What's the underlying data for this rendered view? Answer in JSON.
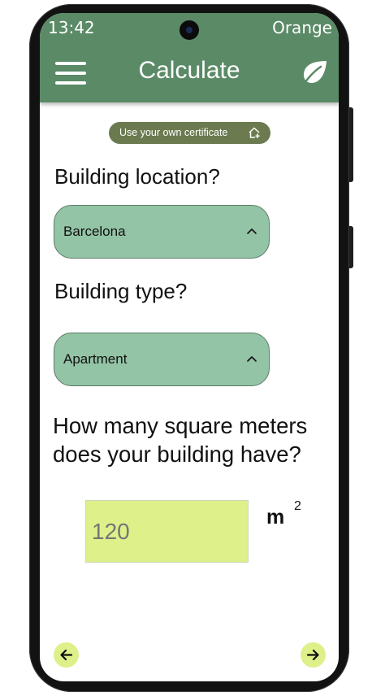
{
  "status_bar": {
    "time": "13:42",
    "carrier": "Orange"
  },
  "app_bar": {
    "title": "Calculate",
    "menu_icon": "hamburger-menu-icon",
    "action_icon": "leaf-icon"
  },
  "certificate_button": {
    "label": "Use your own certificate",
    "icon": "home-plus-icon"
  },
  "questions": {
    "location": "Building location?",
    "type": "Building type?",
    "area": "How many square meters does your building have?"
  },
  "location_dropdown": {
    "value": "Barcelona",
    "icon": "chevron-up-icon"
  },
  "type_dropdown": {
    "value": "Apartment",
    "icon": "chevron-up-icon"
  },
  "area_input": {
    "placeholder": "120",
    "unit": "m",
    "unit_exponent": "2"
  },
  "navigation": {
    "back_icon": "arrow-left-icon",
    "next_icon": "arrow-right-icon"
  },
  "colors": {
    "primary": "#5a8a66",
    "pill": "#6b7a4f",
    "dropdown": "#93c4a5",
    "input": "#def08a"
  }
}
